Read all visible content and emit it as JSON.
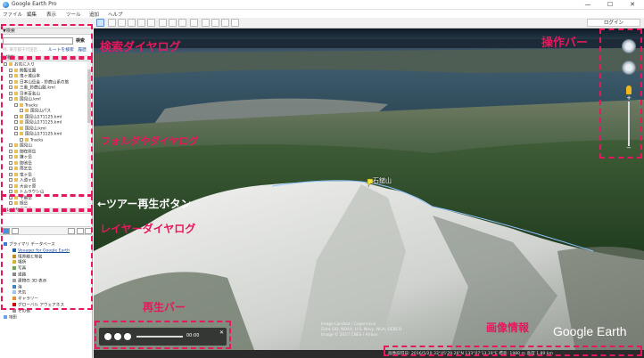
{
  "window": {
    "title": "Google Earth Pro",
    "minimize": "—",
    "maximize": "☐",
    "close": "✕"
  },
  "menu": {
    "items": [
      "ファイル",
      "編集",
      "表示",
      "ツール",
      "追加",
      "ヘルプ"
    ]
  },
  "toolbar": {
    "login_label": "ログイン"
  },
  "search": {
    "header": "▼検索",
    "placeholder": "",
    "button": "検索",
    "hint": "例: 東京都千代田区...",
    "links": [
      "ルートを検索",
      "履歴"
    ]
  },
  "places": {
    "header": "▼場所",
    "items": [
      "お気に入り",
      "閲覧位置",
      "鬼ヶ城山本",
      "日本山岳会 - 鈴鹿山系の旅",
      "三重_鈴鹿山脈.kml",
      "日本百名山",
      "国見山.kml",
      "Tracks",
      "国見山パス",
      "国見山171125.kml",
      "国見山171125.kml",
      "国見山.kml",
      "国見山171125.kml",
      "Tracks",
      "国見山",
      "御在所岳",
      "鎌ヶ岳",
      "御池岳",
      "雨乞岳",
      "竜ヶ岳",
      "入道ヶ岳",
      "大台ヶ原",
      "トムラウシ山",
      "十勝岳",
      "旭岳",
      "摩周岳"
    ]
  },
  "layers": {
    "header": "▼レイヤ",
    "items": [
      "プライマリ データベース",
      "Voyager for Google Earth",
      "境界線と地名",
      "場所",
      "写真",
      "道路",
      "建物の 3D 表示",
      "海",
      "天気",
      "ギャラリー",
      "グローバル アウェアネス",
      "その他",
      "地形"
    ]
  },
  "view": {
    "pin_label": "石鎚山",
    "logo": "Google Earth",
    "credits": [
      "Image Landsat / Copernicus",
      "Data SIO, NOAA, U.S. Navy, NGA, GEBCO",
      "Image © 2017 CNES / Airbus"
    ],
    "status": "画像取得日: 2016/5/20   33°45'29.26\"N 133°07'13.19\"E  標高: 1980 m   高度 1.89 km"
  },
  "player": {
    "time": "00:00",
    "close": "✕"
  },
  "annotations": {
    "search": "検索ダイヤログ",
    "nav": "操作バー",
    "folders": "フォルダやダイヤログ",
    "tour": "←ツアー再生ボタン",
    "layers": "レイヤーダイヤログ",
    "playback": "再生バー",
    "imageinfo": "画像情報"
  },
  "colors": {
    "annotation": "#e8175d",
    "status_bg": "#2b2b2b"
  }
}
